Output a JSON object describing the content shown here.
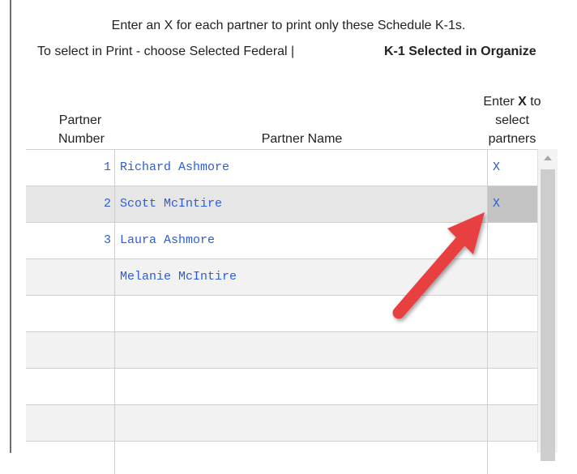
{
  "instructions": {
    "line1": "Enter an X for each partner to print only these Schedule K-1s.",
    "line2": "To select in Print - choose Selected Federal |",
    "line2_bold": "K-1 Selected in Organize"
  },
  "columns": {
    "number_line1": "Partner",
    "number_line2": "Number",
    "name": "Partner Name",
    "select_prefix": "Enter ",
    "select_bold": "X",
    "select_suffix": " to",
    "select_line2": "select",
    "select_line3": "partners"
  },
  "rows": [
    {
      "number": "1",
      "name": "Richard Ashmore",
      "selected": "X"
    },
    {
      "number": "2",
      "name": "Scott McIntire",
      "selected": "X"
    },
    {
      "number": "3",
      "name": "Laura Ashmore",
      "selected": ""
    },
    {
      "number": "",
      "name": "Melanie McIntire",
      "selected": ""
    },
    {
      "number": "",
      "name": "",
      "selected": ""
    },
    {
      "number": "",
      "name": "",
      "selected": ""
    },
    {
      "number": "",
      "name": "",
      "selected": ""
    },
    {
      "number": "",
      "name": "",
      "selected": ""
    },
    {
      "number": "",
      "name": "",
      "selected": ""
    }
  ],
  "annotation": {
    "arrow_color": "#e8403f",
    "arrow_icon": "red-arrow-icon"
  }
}
